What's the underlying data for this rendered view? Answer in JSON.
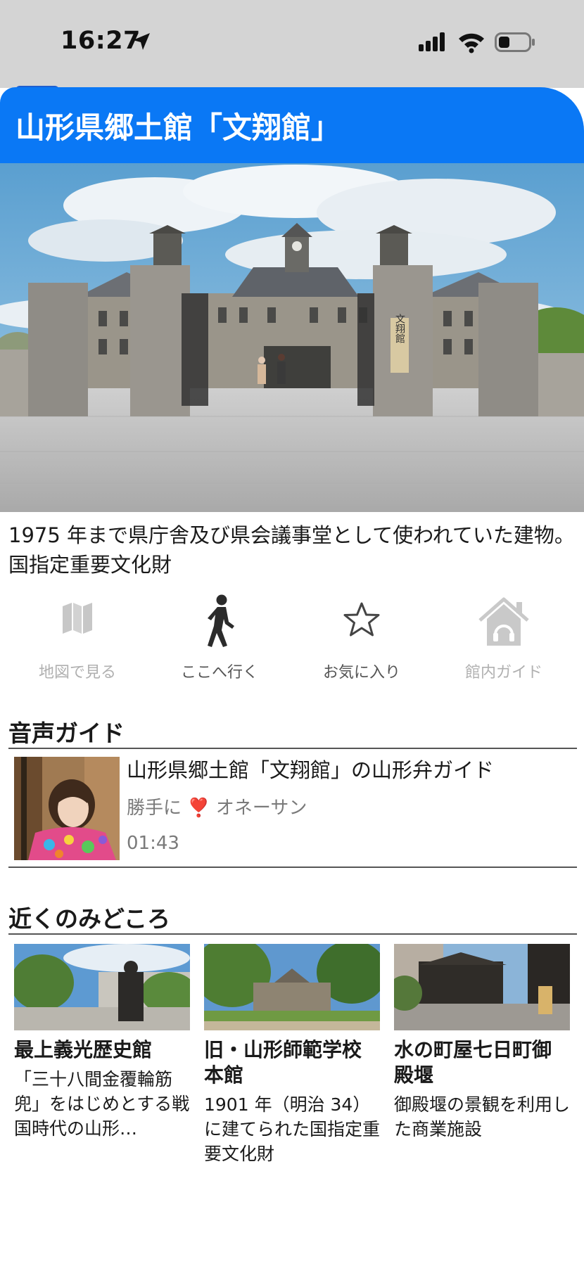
{
  "status_bar": {
    "time": "16:27",
    "icons": [
      "location-arrow-icon",
      "signal-icon",
      "wifi-icon",
      "battery-icon"
    ]
  },
  "header": {
    "title": "山形県郷土館「文翔館」",
    "background_color": "#0a78f5"
  },
  "hero_image": {
    "gate_sign": "文翔館"
  },
  "description": "1975 年まで県庁舎及び県会議事堂として使われていた建物。国指定重要文化財",
  "actions": [
    {
      "label": "地図で見る",
      "icon": "map-icon",
      "enabled": false
    },
    {
      "label": "ここへ行く",
      "icon": "walking-person-icon",
      "enabled": true
    },
    {
      "label": "お気に入り",
      "icon": "star-icon",
      "enabled": true
    },
    {
      "label": "館内ガイド",
      "icon": "house-headphones-icon",
      "enabled": false
    }
  ],
  "audio_guide": {
    "heading": "音声ガイド",
    "items": [
      {
        "title": "山形県郷土館「文翔館」の山形弁ガイド",
        "author_prefix": "勝手に",
        "author_emoji": "❣️",
        "author_name": "オネーサン",
        "duration": "01:43"
      }
    ]
  },
  "nearby": {
    "heading": "近くのみどころ",
    "items": [
      {
        "name": "最上義光歴史館",
        "description": "「三十八間金覆輪筋兜」をはじめとする戦国時代の山形…"
      },
      {
        "name": "旧・山形師範学校本館",
        "description": "1901 年（明治 34）に建てられた国指定重要文化財"
      },
      {
        "name": "水の町屋七日町御殿堰",
        "description": "御殿堰の景観を利用した商業施設"
      }
    ]
  },
  "colors": {
    "accent": "#0a78f5",
    "status_bar_bg": "#d4d4d4",
    "disabled_text": "#b0b0b0",
    "secondary_text": "#7a7a7a"
  }
}
